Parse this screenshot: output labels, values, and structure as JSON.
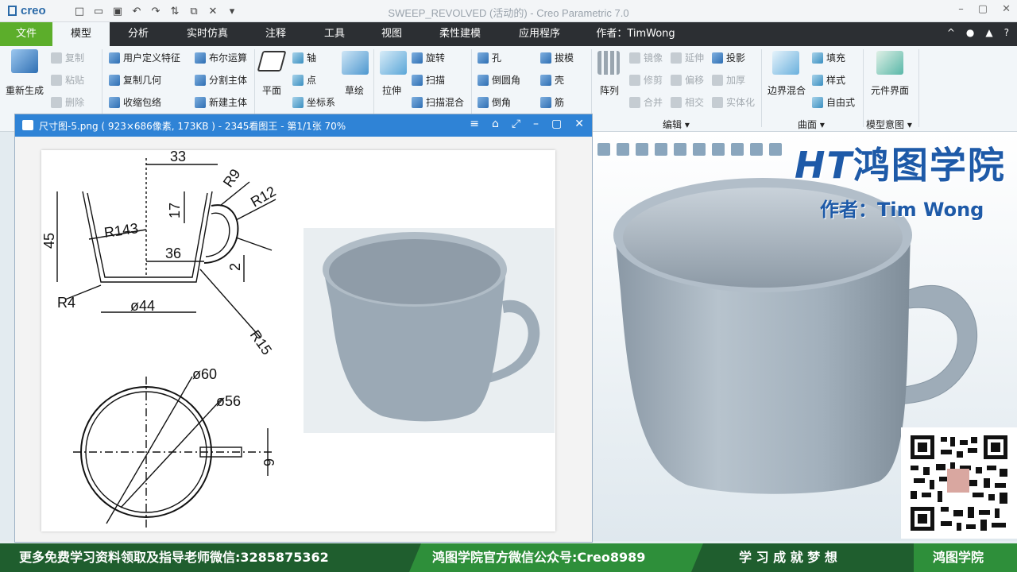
{
  "app": {
    "window_title": "SWEEP_REVOLVED (活动的) - Creo Parametric 7.0",
    "logo": "creo"
  },
  "menu": {
    "tabs": [
      "文件",
      "模型",
      "分析",
      "实时仿真",
      "注释",
      "工具",
      "视图",
      "柔性建模",
      "应用程序",
      "作者：TimWong"
    ],
    "active_tab": "模型"
  },
  "ribbon": {
    "regen": "重新生成",
    "copy": "复制",
    "paste": "粘贴",
    "delete": "删除",
    "udf": "用户定义特征",
    "copy_geom": "复制几何",
    "shrinkwrap": "收缩包络",
    "boolean": "布尔运算",
    "split_body": "分割主体",
    "new_body": "新建主体",
    "plane": "平面",
    "axis": "轴",
    "point": "点",
    "csys": "坐标系",
    "sketch": "草绘",
    "extrude": "拉伸",
    "revolve": "旋转",
    "sweep": "扫描",
    "swept_blend": "扫描混合",
    "hole": "孔",
    "round": "倒圆角",
    "chamfer": "倒角",
    "draft": "拔模",
    "shell": "壳",
    "rib": "筋",
    "pattern": "阵列",
    "mirror": "镜像",
    "trim": "修剪",
    "merge": "合并",
    "extend": "延伸",
    "offset": "偏移",
    "intersect": "相交",
    "project": "投影",
    "thicken": "加厚",
    "solidify": "实体化",
    "boundary_blend": "边界混合",
    "fill": "填充",
    "style": "样式",
    "freestyle": "自由式",
    "component_interface": "元件界面",
    "group_edit": "编辑",
    "group_surface": "曲面",
    "group_intent": "模型意图"
  },
  "viewer": {
    "title": "尺寸图-5.png ( 923×686像素, 173KB ) - 2345看图王 - 第1/1张 70%"
  },
  "drawing": {
    "dims": [
      "33",
      "R9",
      "R12",
      "17",
      "45",
      "R143",
      "36",
      "2",
      "R4",
      "ø44",
      "R15",
      "ø60",
      "ø56",
      "6"
    ]
  },
  "overlay": {
    "brand": "鸿图学院",
    "brand_prefix": "HT",
    "author": "作者：Tim Wong"
  },
  "bottom": {
    "left": "更多免费学习资料领取及指导老师微信:3285875362",
    "middle": "鸿图学院官方微信公众号:Creo8989",
    "slogan": "学 习 成 就 梦 想",
    "right": "鸿图学院"
  }
}
